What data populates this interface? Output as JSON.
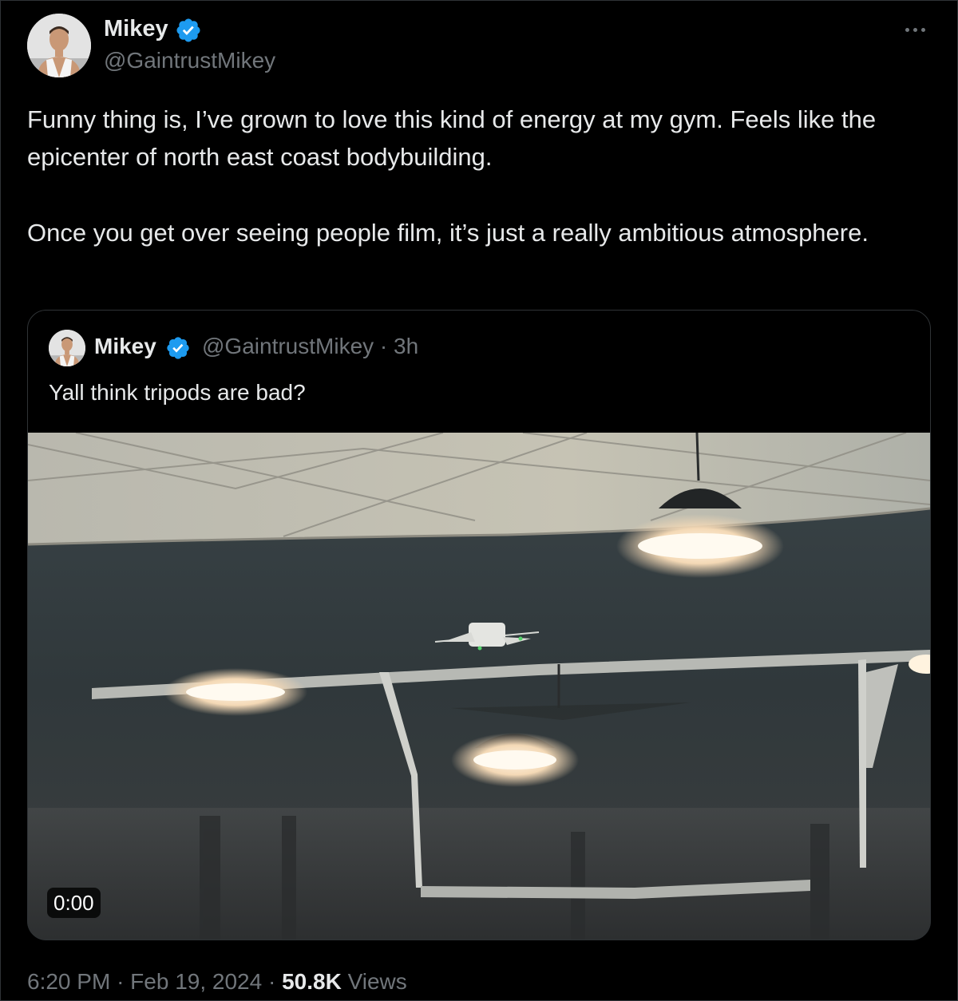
{
  "tweet": {
    "author_name": "Mikey",
    "author_handle": "@GaintrustMikey",
    "verified_icon": "verified-badge-icon",
    "more_icon": "more-options-icon",
    "text_paragraphs": [
      "Funny thing is, I’ve grown to love this kind of energy at my gym. Feels like the epicenter of north east coast bodybuilding.",
      "Once you get over seeing people film, it’s just a really ambitious atmosphere."
    ],
    "time": "6:20 PM",
    "date": "Feb 19, 2024",
    "separator": "·",
    "views_count": "50.8K",
    "views_label": "Views"
  },
  "quoted": {
    "author_name": "Mikey",
    "author_handle": "@GaintrustMikey · 3h",
    "text": "Yall think tripods are bad?",
    "video_duration": "0:00"
  },
  "colors": {
    "background": "#000000",
    "primary_text": "#e7e9ea",
    "secondary_text": "#71767b",
    "border": "#2f3336",
    "verified_blue": "#1d9bf0"
  }
}
